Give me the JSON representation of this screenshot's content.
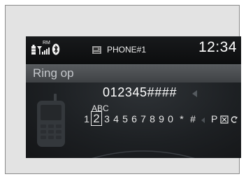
{
  "status": {
    "battery_icon": "battery-icon",
    "signal_icon": "signal-icon",
    "roaming_label": "RM",
    "bluetooth_icon": "bluetooth-icon",
    "phone_icon": "phone-device-icon",
    "phone_name": "PHONE#1",
    "clock": "12:34"
  },
  "title": "Ring op",
  "dialed_number": "012345####",
  "keypad": {
    "letters": "ABC",
    "keys": [
      "1",
      "2",
      "3",
      "4",
      "5",
      "6",
      "7",
      "8",
      "9",
      "0",
      "*",
      "#",
      "P"
    ],
    "selected_key": "2",
    "delete_icon": "delete-icon",
    "back_icon": "back-icon"
  },
  "colors": {
    "screen_bg": "#111214",
    "title_bar": "#4a4d51",
    "text": "#ffffff"
  }
}
